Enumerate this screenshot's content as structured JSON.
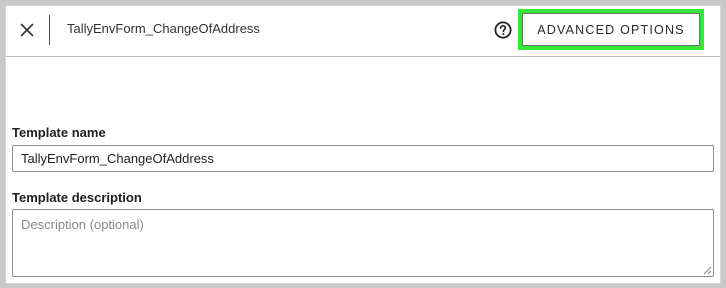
{
  "header": {
    "close_icon": "close-icon",
    "title": "TallyEnvForm_ChangeOfAddress",
    "help_icon": "help-circle-icon",
    "advanced_options_label": "ADVANCED OPTIONS",
    "highlight_color": "#34e834"
  },
  "form": {
    "template_name": {
      "label": "Template name",
      "value": "TallyEnvForm_ChangeOfAddress"
    },
    "template_description": {
      "label": "Template description",
      "placeholder": "Description (optional)",
      "value": ""
    }
  }
}
